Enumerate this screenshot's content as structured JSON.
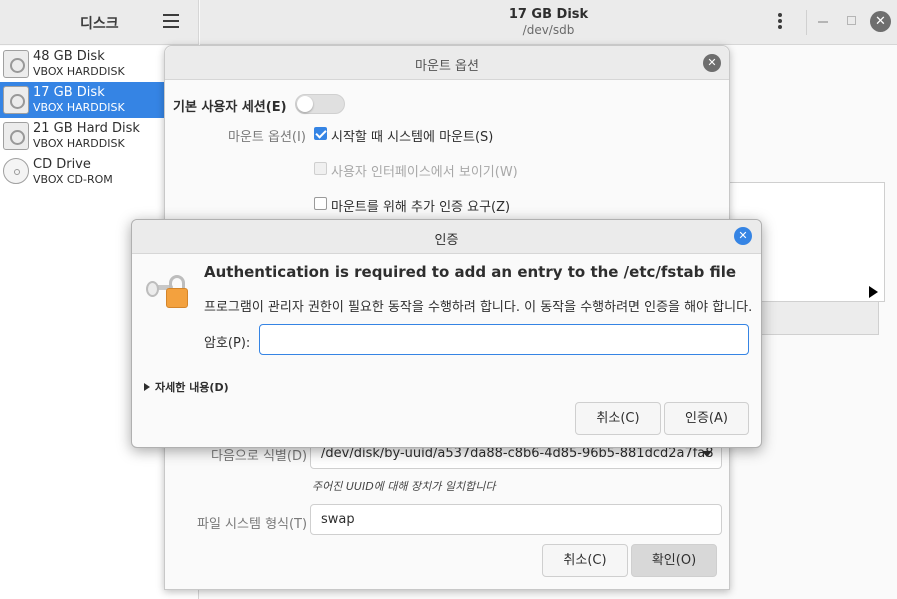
{
  "sidebar": {
    "title": "디스크",
    "disks": [
      {
        "name": "48 GB Disk",
        "model": "VBOX HARDDISK",
        "icon": "hard-disk-icon"
      },
      {
        "name": "17 GB Disk",
        "model": "VBOX HARDDISK",
        "icon": "hard-disk-icon",
        "selected": true
      },
      {
        "name": "21 GB Hard Disk",
        "model": "VBOX HARDDISK",
        "icon": "hard-disk-icon"
      },
      {
        "name": "CD Drive",
        "model": "VBOX CD-ROM",
        "icon": "cd-icon"
      }
    ]
  },
  "header": {
    "title": "17 GB Disk",
    "subtitle": "/dev/sdb"
  },
  "mount_dialog": {
    "title": "마운트 옵션",
    "user_session_label": "기본 사용자 세션(E)",
    "user_session_on": false,
    "mount_options_label": "마운트 옵션(I)",
    "mount_at_startup": {
      "label": "시작할 때 시스템에 마운트(S)",
      "checked": true
    },
    "show_in_ui": {
      "label": "사용자 인터페이스에서 보이기(W)",
      "checked": false,
      "disabled": true
    },
    "require_auth": {
      "label": "마운트를 위해 추가 인증 요구(Z)",
      "checked": false
    },
    "identify_as_label": "다음으로 식별(D)",
    "identify_as_value": "/dev/disk/by-uuid/a537da88-c8b6-4d85-96b5-881dcd2a7fa8",
    "identify_hint": "주어진 UUID에 대해 장치가 일치합니다",
    "fs_type_label": "파일 시스템 형식(T)",
    "fs_type_value": "swap",
    "cancel_label": "취소(C)",
    "ok_label": "확인(O)"
  },
  "auth_dialog": {
    "title": "인증",
    "heading": "Authentication is required to add an entry to the /etc/fstab file",
    "description": "프로그램이 관리자 권한이 필요한 동작을 수행하려 합니다. 이 동작을 수행하려면 인증을 해야 합니다.",
    "password_label": "암호(P):",
    "password_value": "",
    "details_label": "자세한 내용(D)",
    "cancel_label": "취소(C)",
    "auth_label": "인증(A)"
  },
  "colors": {
    "accent": "#3584e4",
    "lock": "#f3a13e"
  }
}
